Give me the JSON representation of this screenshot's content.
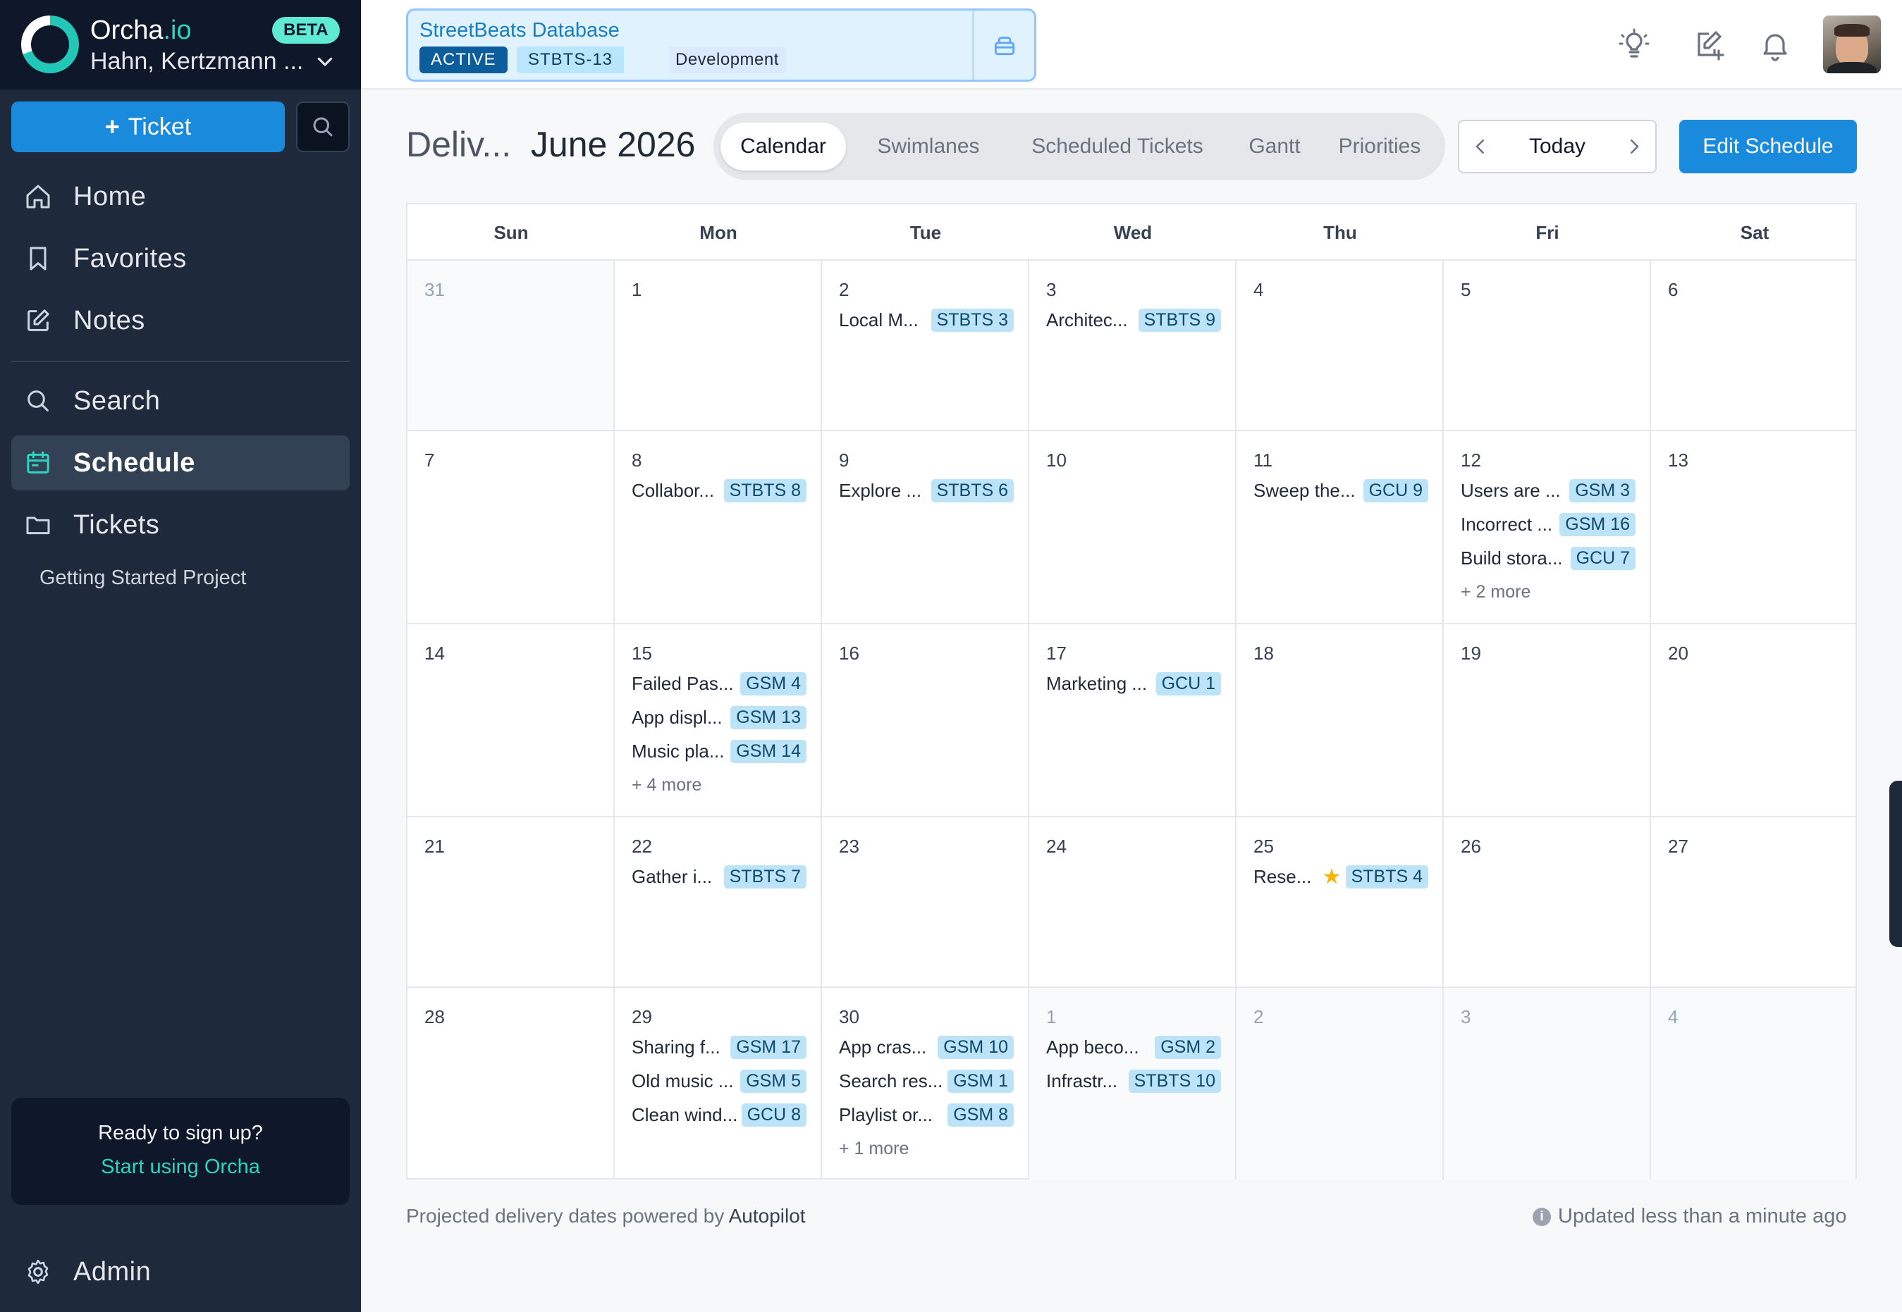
{
  "app": {
    "brand_name": "Orcha",
    "brand_tld": ".io",
    "beta_label": "BETA",
    "org_name": "Hahn, Kertzmann ...",
    "new_ticket_label": "Ticket"
  },
  "sidebar": {
    "items": [
      {
        "label": "Home"
      },
      {
        "label": "Favorites"
      },
      {
        "label": "Notes"
      },
      {
        "label": "Search"
      },
      {
        "label": "Schedule"
      },
      {
        "label": "Tickets"
      }
    ],
    "project": "Getting Started Project",
    "signup_question": "Ready to sign up?",
    "signup_link": "Start using Orcha",
    "admin_label": "Admin"
  },
  "topbar": {
    "project_name": "StreetBeats Database",
    "status": "ACTIVE",
    "key": "STBTS-13",
    "stage": "Development"
  },
  "toolbar": {
    "view_name": "Deliv...",
    "month": "June 2026",
    "tabs": [
      "Calendar",
      "Swimlanes",
      "Scheduled Tickets",
      "Gantt",
      "Priorities"
    ],
    "today_label": "Today",
    "edit_label": "Edit Schedule"
  },
  "calendar": {
    "days_of_week": [
      "Sun",
      "Mon",
      "Tue",
      "Wed",
      "Thu",
      "Fri",
      "Sat"
    ],
    "weeks": [
      [
        {
          "d": "31",
          "out": true,
          "events": []
        },
        {
          "d": "1",
          "events": []
        },
        {
          "d": "2",
          "events": [
            {
              "t": "Local M...",
              "b": "STBTS 3"
            }
          ]
        },
        {
          "d": "3",
          "events": [
            {
              "t": "Architec...",
              "b": "STBTS 9"
            }
          ]
        },
        {
          "d": "4",
          "events": []
        },
        {
          "d": "5",
          "events": []
        },
        {
          "d": "6",
          "events": []
        }
      ],
      [
        {
          "d": "7",
          "events": []
        },
        {
          "d": "8",
          "events": [
            {
              "t": "Collabor...",
              "b": "STBTS 8"
            }
          ]
        },
        {
          "d": "9",
          "events": [
            {
              "t": "Explore ...",
              "b": "STBTS 6"
            }
          ]
        },
        {
          "d": "10",
          "events": []
        },
        {
          "d": "11",
          "events": [
            {
              "t": "Sweep the...",
              "b": "GCU 9"
            }
          ]
        },
        {
          "d": "12",
          "events": [
            {
              "t": "Users are ...",
              "b": "GSM 3"
            },
            {
              "t": "Incorrect ...",
              "b": "GSM 16"
            },
            {
              "t": "Build stora...",
              "b": "GCU 7"
            }
          ],
          "more": "+ 2 more"
        },
        {
          "d": "13",
          "events": []
        }
      ],
      [
        {
          "d": "14",
          "events": []
        },
        {
          "d": "15",
          "events": [
            {
              "t": "Failed Pas...",
              "b": "GSM 4"
            },
            {
              "t": "App displ...",
              "b": "GSM 13"
            },
            {
              "t": "Music pla...",
              "b": "GSM 14"
            }
          ],
          "more": "+ 4 more"
        },
        {
          "d": "16",
          "events": []
        },
        {
          "d": "17",
          "events": [
            {
              "t": "Marketing ...",
              "b": "GCU 1"
            }
          ]
        },
        {
          "d": "18",
          "events": []
        },
        {
          "d": "19",
          "events": []
        },
        {
          "d": "20",
          "events": []
        }
      ],
      [
        {
          "d": "21",
          "events": []
        },
        {
          "d": "22",
          "events": [
            {
              "t": "Gather i...",
              "b": "STBTS 7"
            }
          ]
        },
        {
          "d": "23",
          "events": []
        },
        {
          "d": "24",
          "events": []
        },
        {
          "d": "25",
          "events": [
            {
              "t": "Rese...",
              "b": "STBTS 4",
              "star": true
            }
          ]
        },
        {
          "d": "26",
          "events": []
        },
        {
          "d": "27",
          "events": []
        }
      ],
      [
        {
          "d": "28",
          "events": []
        },
        {
          "d": "29",
          "events": [
            {
              "t": "Sharing f...",
              "b": "GSM 17"
            },
            {
              "t": "Old music ...",
              "b": "GSM 5"
            },
            {
              "t": "Clean wind...",
              "b": "GCU 8"
            }
          ]
        },
        {
          "d": "30",
          "events": [
            {
              "t": "App cras...",
              "b": "GSM 10"
            },
            {
              "t": "Search res...",
              "b": "GSM 1"
            },
            {
              "t": "Playlist or...",
              "b": "GSM 8"
            }
          ],
          "more": "+ 1 more"
        },
        {
          "d": "1",
          "out": true,
          "events": [
            {
              "t": "App beco...",
              "b": "GSM 2"
            },
            {
              "t": "Infrastr...",
              "b": "STBTS 10"
            }
          ]
        },
        {
          "d": "2",
          "out": true,
          "events": []
        },
        {
          "d": "3",
          "out": true,
          "events": []
        },
        {
          "d": "4",
          "out": true,
          "events": []
        }
      ]
    ]
  },
  "footer": {
    "powered_prefix": "Projected delivery dates powered by",
    "powered_by": "Autopilot",
    "updated": "Updated less than a minute ago"
  },
  "colors": {
    "accent": "#1a8bdc",
    "sidebar_bg": "#1e293b",
    "teal": "#2dd4bf",
    "badge_bg": "#bde3f8"
  }
}
